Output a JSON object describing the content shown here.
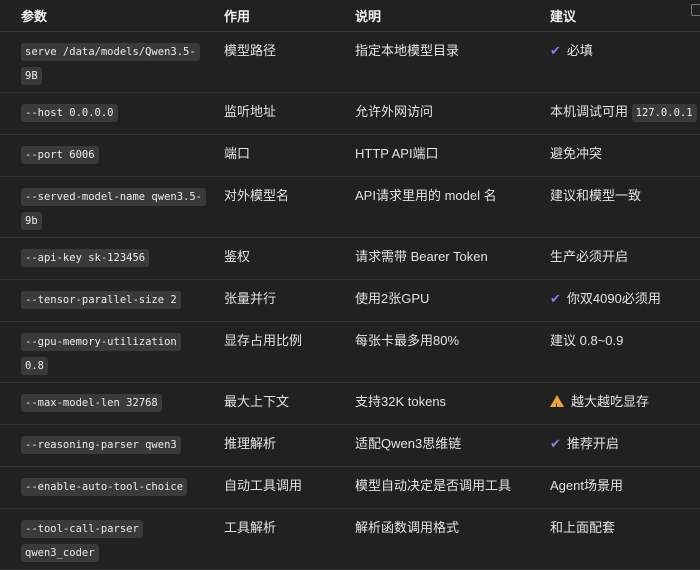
{
  "headers": [
    "参数",
    "作用",
    "说明",
    "建议"
  ],
  "rows": [
    {
      "param": "serve /data/models/Qwen3.5-9B",
      "role": "模型路径",
      "desc": "指定本地模型目录",
      "advice_icon": "check",
      "advice": "必填"
    },
    {
      "param": "--host 0.0.0.0",
      "role": "监听地址",
      "desc": "允许外网访问",
      "advice": "本机调试可用",
      "advice_code": "127.0.0.1"
    },
    {
      "param": "--port 6006",
      "role": "端口",
      "desc": "HTTP API端口",
      "advice": "避免冲突"
    },
    {
      "param": "--served-model-name qwen3.5-9b",
      "role": "对外模型名",
      "desc": "API请求里用的 model 名",
      "advice": "建议和模型一致"
    },
    {
      "param": "--api-key sk-123456",
      "role": "鉴权",
      "desc": "请求需带 Bearer Token",
      "advice": "生产必须开启"
    },
    {
      "param": "--tensor-parallel-size 2",
      "role": "张量并行",
      "desc": "使用2张GPU",
      "advice_icon": "check",
      "advice": "你双4090必须用"
    },
    {
      "param": "--gpu-memory-utilization 0.8",
      "role": "显存占用比例",
      "desc": "每张卡最多用80%",
      "advice": "建议 0.8~0.9"
    },
    {
      "param": "--max-model-len 32768",
      "role": "最大上下文",
      "desc": "支持32K tokens",
      "advice_icon": "warning",
      "advice": "越大越吃显存"
    },
    {
      "param": "--reasoning-parser qwen3",
      "role": "推理解析",
      "desc": "适配Qwen3思维链",
      "advice_icon": "check",
      "advice": "推荐开启"
    },
    {
      "param": "--enable-auto-tool-choice",
      "role": "自动工具调用",
      "desc": "模型自动决定是否调用工具",
      "advice": "Agent场景用"
    },
    {
      "param": "--tool-call-parser qwen3_coder",
      "role": "工具解析",
      "desc": "解析函数调用格式",
      "advice": "和上面配套"
    }
  ]
}
